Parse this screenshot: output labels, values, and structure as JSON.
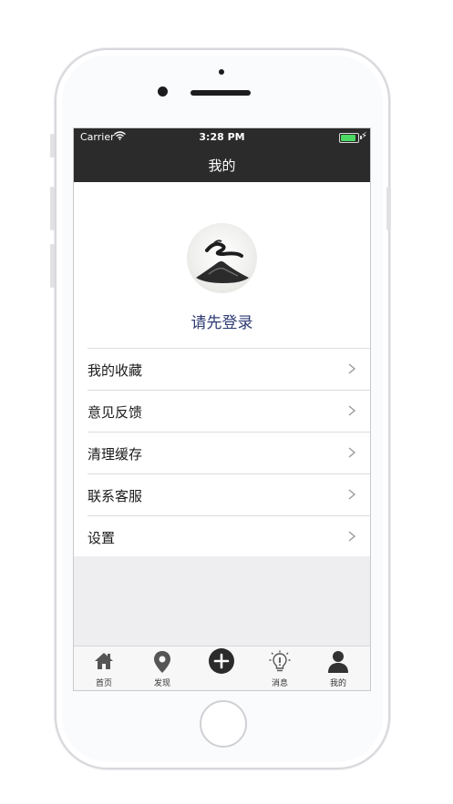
{
  "status_bar": {
    "carrier": "Carrier",
    "time": "3:28 PM",
    "battery_level": 1.0
  },
  "nav": {
    "title": "我的"
  },
  "profile": {
    "login_prompt": "请先登录"
  },
  "menu": {
    "items": [
      {
        "label": "我的收藏"
      },
      {
        "label": "意见反馈"
      },
      {
        "label": "清理缓存"
      },
      {
        "label": "联系客服"
      },
      {
        "label": "设置"
      }
    ]
  },
  "tabbar": {
    "items": [
      {
        "label": "首页",
        "icon": "home-icon"
      },
      {
        "label": "发现",
        "icon": "location-pin-icon"
      },
      {
        "label": "",
        "icon": "add-icon"
      },
      {
        "label": "消息",
        "icon": "lightbulb-icon"
      },
      {
        "label": "我的",
        "icon": "person-icon"
      }
    ]
  },
  "colors": {
    "nav_background": "#2b2b2b",
    "login_text": "#2e3b73",
    "battery": "#4cd964",
    "tab_icon": "#555555"
  }
}
